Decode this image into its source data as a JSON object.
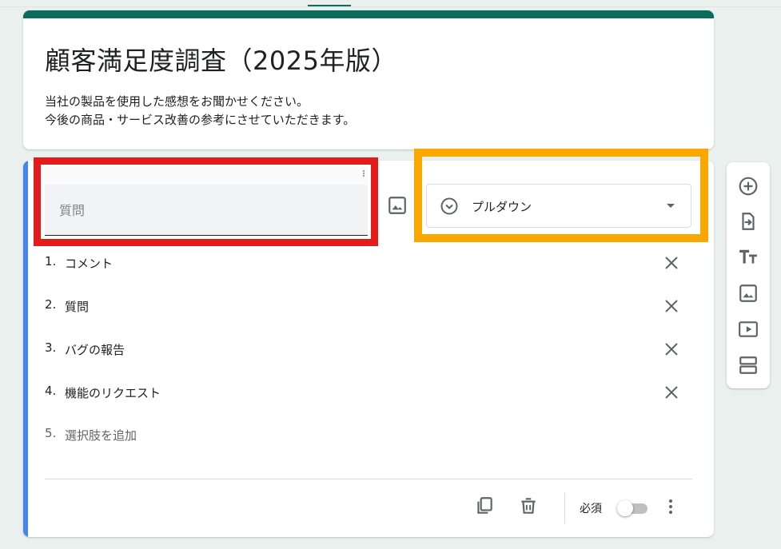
{
  "form": {
    "title": "顧客満足度調査（2025年版）",
    "description_line1": "当社の製品を使用した感想をお聞かせください。",
    "description_line2": "今後の商品・サービス改善の参考にさせていただきます。"
  },
  "question": {
    "placeholder": "質問",
    "type_label": "プルダウン",
    "options": [
      {
        "num": "1.",
        "text": "コメント"
      },
      {
        "num": "2.",
        "text": "質問"
      },
      {
        "num": "3.",
        "text": "バグの報告"
      },
      {
        "num": "4.",
        "text": "機能のリクエスト"
      }
    ],
    "add_option": {
      "num": "5.",
      "text": "選択肢を追加"
    },
    "required_label": "必須",
    "required": false
  },
  "colors": {
    "accent": "#0b6b5c",
    "question_accent": "#4285f4",
    "highlight_red": "#e31b1b",
    "highlight_orange": "#f9a800"
  },
  "icons": {
    "question_image": "image-icon",
    "dropdown_type": "circle-chevron-icon",
    "option_remove": "close-icon",
    "duplicate": "copy-icon",
    "delete": "trash-icon",
    "more": "more-vert-icon",
    "toolbar": [
      "add-circle-icon",
      "import-icon",
      "title-icon",
      "image-icon",
      "video-icon",
      "section-icon"
    ]
  }
}
